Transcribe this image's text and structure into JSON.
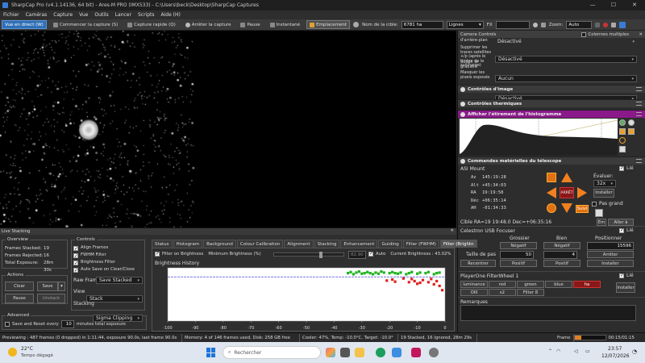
{
  "window": {
    "title": "SharpCap Pro (v4.1.14136, 64 bit) - Ares-M PRO (IMX533) - C:\\Users\\beck\\Desktop\\SharpCap Captures"
  },
  "menu": [
    "Fichier",
    "Caméras",
    "Capture",
    "Vue",
    "Outils",
    "Lancer",
    "Scripts",
    "Aide (H)"
  ],
  "toolbar": {
    "live": "Vue en direct (W)",
    "start_capture": "Commencer la capture (S)",
    "quick_capture": "Capture rapide (Q)",
    "stop_capture": "Arrêter la capture",
    "pause": "Pause",
    "snapshot": "Instantané",
    "placement": "Emplacement",
    "target_label": "Nom de la cible:",
    "target_value": "6781 ha",
    "mode_value": "Lignes",
    "fx": "FX",
    "zoom_label": "Zoom:",
    "zoom_value": "Auto"
  },
  "camera_controls": {
    "title": "Camera Controls",
    "multi_columns": "Colonnes multiples",
    "rows": [
      {
        "label": "d'arrière-plan",
        "value": "Désactivé"
      },
      {
        "label": "Supprimer les traces satellites +/p (après le timbre de la surcharge)",
        "value": "Désactivé"
      },
      {
        "label": "Suppr. le gradient",
        "value": "Aucun"
      },
      {
        "label": "Masquer les pixels exposés",
        "value": "Désactivé"
      }
    ],
    "sections": {
      "image_controls": "Contrôles d'image",
      "thermal_controls": "Contrôles thermiques",
      "histogram": "Afficher l'étirement de l'histogramme",
      "mount_commands": "Commandes matérielles du télescope"
    }
  },
  "mount": {
    "title": "ASI Mount",
    "link": "Lié",
    "coords": [
      {
        "label": "Az",
        "value": "145:19:28"
      },
      {
        "label": "Alt",
        "value": "+45:34:03"
      },
      {
        "label": "RA",
        "value": "19:19:58"
      },
      {
        "label": "Déc",
        "value": "+06:35:14"
      },
      {
        "label": "AH",
        "value": "-01:34:33"
      }
    ],
    "stop": "ARRÊT",
    "follow": "Suivi",
    "rate_label": "Évaluer:",
    "rate_value": "32x",
    "install": "Installer",
    "pier_side": "Pas grand",
    "target_text": "Cible   RA=19 19:48.0 Dec=+06:35:16",
    "goto": "Aller à",
    "en": "Em"
  },
  "focuser": {
    "title": "Celestron USB Focuser",
    "link": "Lié",
    "headers": [
      "Grossier",
      "Bien",
      "Positionner"
    ],
    "negative": "Négatif",
    "positive": "Positif",
    "position_value": "15596",
    "step_label": "Taille de pas",
    "coarse_step": "50",
    "fine_step": "4",
    "stop": "Arrêter",
    "center": "Recentrer",
    "install": "Installer"
  },
  "filterwheel": {
    "title": "PlayerOne FilterWheel 1",
    "link": "Lié",
    "filters_row1": [
      "luminance",
      "red",
      "green",
      "blue",
      "ha"
    ],
    "filters_row2": [
      "OIII",
      "s2",
      "Filter 8"
    ],
    "install": "Installer"
  },
  "remarks": {
    "label": "Remarques"
  },
  "live_stacking": {
    "title": "Live Stacking",
    "overview": {
      "label": "Overview",
      "frames_stacked_label": "Frames Stacked:",
      "frames_stacked": "19",
      "frames_rejected_label": "Frames Rejected:",
      "frames_rejected": "16",
      "total_exposure_label": "Total Exposure:",
      "total_exposure": "28m 30s"
    },
    "actions": {
      "label": "Actions",
      "clear": "Clear",
      "save": "Save",
      "pause": "Pause",
      "unstack": "Unstack"
    },
    "advanced": {
      "label": "Advanced",
      "save_reset_label": "Save and Reset every",
      "save_reset_value": "10",
      "save_reset_suffix": "minutes total exposure"
    },
    "controls": {
      "label": "Controls",
      "align_frames": "Align Frames",
      "fwhm_filter": "FWHM Filter",
      "brightness_filter": "Brightness Filter",
      "auto_save": "Auto Save on Clear/Close",
      "raw_frames_label": "Raw Frames",
      "raw_frames_value": "Save Stacked",
      "view_label": "View",
      "view_value": "Stack",
      "stacking_label": "Stacking",
      "stacking_value": "Sigma Clipping"
    },
    "tabs": [
      "Status",
      "Histogram",
      "Background",
      "Colour Calibration",
      "Alignment",
      "Stacking",
      "Enhancement",
      "Guiding",
      "Filter (FWHM)",
      "Filter (Brightn"
    ],
    "filter_brightness": {
      "filter_on_label": "Filter on Brightness",
      "min_brightness_label": "Minimum Brightness (%)",
      "min_brightness_value": "82.90",
      "auto_label": "Auto",
      "current_brightness": "Current Brightness : 43.02%",
      "history_label": "Brightness History"
    }
  },
  "chart_data": {
    "type": "scatter",
    "x_ticks": [
      -100,
      -90,
      -80,
      -70,
      -60,
      -50,
      -40,
      -30,
      -20,
      -10,
      0
    ],
    "xlim": [
      -100,
      0
    ],
    "ylim": [
      0,
      100
    ],
    "threshold": 82.9,
    "series": [
      {
        "color": "#1fb31f",
        "points": [
          [
            -35,
            90
          ],
          [
            -34,
            92
          ],
          [
            -33,
            88
          ],
          [
            -32,
            91
          ],
          [
            -31,
            93
          ],
          [
            -30,
            89
          ],
          [
            -29,
            90
          ],
          [
            -28,
            92
          ],
          [
            -27,
            90
          ],
          [
            -26,
            88
          ],
          [
            -25,
            91
          ],
          [
            -24,
            89
          ],
          [
            -23,
            93
          ],
          [
            -22,
            91
          ],
          [
            -20,
            90
          ],
          [
            -19,
            92
          ],
          [
            -18,
            90
          ],
          [
            -17,
            89
          ],
          [
            -16,
            91
          ],
          [
            -14,
            88
          ],
          [
            -13,
            90
          ],
          [
            -12,
            92
          ],
          [
            -10,
            89
          ],
          [
            -9,
            91
          ],
          [
            -7,
            90
          ],
          [
            -6,
            92
          ],
          [
            -4,
            88
          ],
          [
            -3,
            90
          ],
          [
            -2,
            91
          ]
        ]
      },
      {
        "color": "#e02020",
        "points": [
          [
            -21,
            76
          ],
          [
            -19,
            78
          ],
          [
            -18,
            74
          ],
          [
            -15,
            80
          ],
          [
            -13,
            73
          ],
          [
            -12,
            79
          ],
          [
            -11,
            75
          ],
          [
            -10,
            70
          ],
          [
            -9,
            72
          ],
          [
            -8,
            77
          ],
          [
            -6,
            73
          ],
          [
            -5,
            79
          ],
          [
            -4,
            69
          ],
          [
            -3,
            75
          ],
          [
            -2,
            66
          ],
          [
            -1,
            58
          ]
        ]
      }
    ]
  },
  "status": {
    "previewing": "Previewing : 487 frames (0 dropped) in 1:11:44, exposure 90.0s, last frame 90.0s",
    "memory": "Memory: 4 of 146 frames used, Disk: 258 GB free",
    "cooler": "Cooler: 47%, Temp: -10.0°C, Target: -10.0°",
    "stacked": "19 Stacked, 16 Ignored, 28m 29s",
    "frame_label": "Frame",
    "time": "00:15/01:15"
  },
  "taskbar": {
    "weather_temp": "22°C",
    "weather_desc": "Temps dégagé",
    "search_placeholder": "Rechercher",
    "clock_time": "23:57",
    "clock_date": "12/07/2026"
  }
}
